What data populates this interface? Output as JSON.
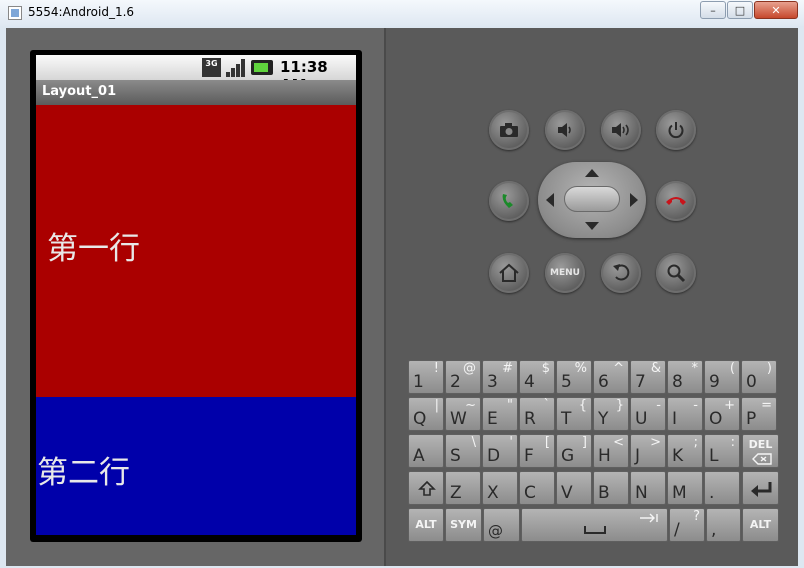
{
  "window": {
    "title": "5554:Android_1.6"
  },
  "status_bar": {
    "network_label": "3G",
    "time": "11:38 AM"
  },
  "app": {
    "title": "Layout_01"
  },
  "rows": [
    {
      "text": "第一行",
      "color": "#aa0000"
    },
    {
      "text": "第二行",
      "color": "#0000aa"
    }
  ],
  "hardware_buttons": {
    "top": [
      "camera-icon",
      "volume-down-icon",
      "volume-up-icon",
      "power-icon"
    ],
    "bottom": [
      "home-icon",
      "menu",
      "back-icon",
      "search-icon"
    ],
    "menu_label": "MENU"
  },
  "keyboard": {
    "row1": [
      {
        "main": "1",
        "sub": "!"
      },
      {
        "main": "2",
        "sub": "@"
      },
      {
        "main": "3",
        "sub": "#"
      },
      {
        "main": "4",
        "sub": "$"
      },
      {
        "main": "5",
        "sub": "%"
      },
      {
        "main": "6",
        "sub": "^"
      },
      {
        "main": "7",
        "sub": "&"
      },
      {
        "main": "8",
        "sub": "*"
      },
      {
        "main": "9",
        "sub": "("
      },
      {
        "main": "0",
        "sub": ")"
      }
    ],
    "row2": [
      {
        "main": "Q",
        "sub": "|"
      },
      {
        "main": "W",
        "sub": "~"
      },
      {
        "main": "E",
        "sub": "\""
      },
      {
        "main": "R",
        "sub": "`"
      },
      {
        "main": "T",
        "sub": "{"
      },
      {
        "main": "Y",
        "sub": "}"
      },
      {
        "main": "U",
        "sub": "-"
      },
      {
        "main": "I",
        "sub": "-"
      },
      {
        "main": "O",
        "sub": "+"
      },
      {
        "main": "P",
        "sub": "="
      }
    ],
    "row3": [
      {
        "main": "A",
        "sub": ""
      },
      {
        "main": "S",
        "sub": "\\"
      },
      {
        "main": "D",
        "sub": "'"
      },
      {
        "main": "F",
        "sub": "["
      },
      {
        "main": "G",
        "sub": "]"
      },
      {
        "main": "H",
        "sub": "<"
      },
      {
        "main": "J",
        "sub": ">"
      },
      {
        "main": "K",
        "sub": ";"
      },
      {
        "main": "L",
        "sub": ":"
      }
    ],
    "del_label": "DEL",
    "row4": [
      {
        "main": "Z",
        "sub": ""
      },
      {
        "main": "X",
        "sub": ""
      },
      {
        "main": "C",
        "sub": ""
      },
      {
        "main": "V",
        "sub": ""
      },
      {
        "main": "B",
        "sub": ""
      },
      {
        "main": "N",
        "sub": ""
      },
      {
        "main": "M",
        "sub": ""
      },
      {
        "main": ".",
        "sub": ""
      }
    ],
    "alt_label": "ALT",
    "sym_label": "SYM",
    "at_label": "@",
    "slash": {
      "main": "/",
      "sub": "?"
    },
    "comma": {
      "main": ",",
      "sub": ""
    }
  }
}
